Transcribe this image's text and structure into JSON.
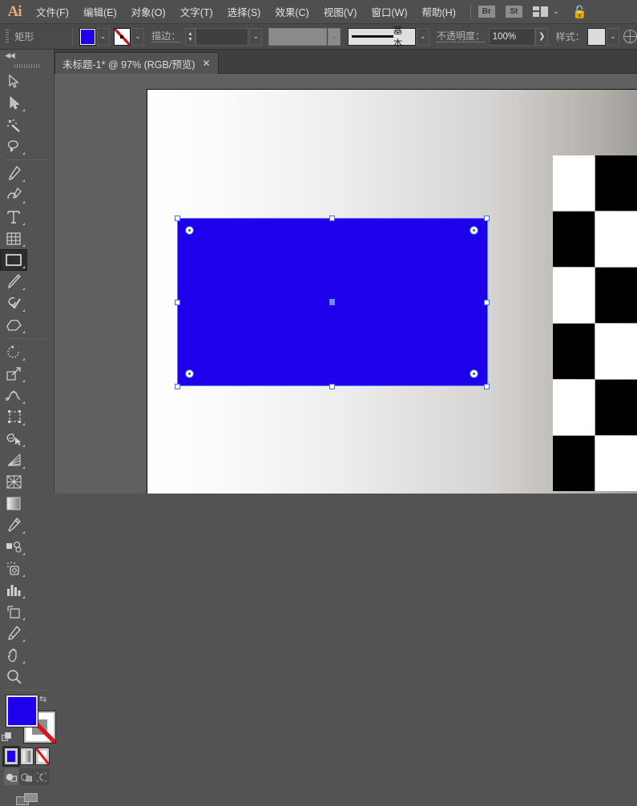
{
  "app": {
    "name": "Adobe Illustrator",
    "logo": "Ai"
  },
  "menubar": {
    "items": [
      {
        "label": "文件(F)",
        "name": "menu-file"
      },
      {
        "label": "编辑(E)",
        "name": "menu-edit"
      },
      {
        "label": "对象(O)",
        "name": "menu-object"
      },
      {
        "label": "文字(T)",
        "name": "menu-type"
      },
      {
        "label": "选择(S)",
        "name": "menu-select"
      },
      {
        "label": "效果(C)",
        "name": "menu-effect"
      },
      {
        "label": "视图(V)",
        "name": "menu-view"
      },
      {
        "label": "窗口(W)",
        "name": "menu-window"
      },
      {
        "label": "帮助(H)",
        "name": "menu-help"
      }
    ],
    "bridge_badge": "Br",
    "stock_badge": "St"
  },
  "controlbar": {
    "tool_name": "矩形",
    "fill_color": "#1e00ea",
    "stroke_color": "none",
    "stroke_label": "描边：",
    "stroke_width": "",
    "variable_width": "",
    "brush_label": "基本",
    "opacity_label": "不透明度：",
    "opacity_value": "100%",
    "style_label": "样式："
  },
  "tabbar": {
    "document_title": "未标题-1* @ 97% (RGB/预览)",
    "close_glyph": "✕"
  },
  "toolpanel": {
    "collapse_glyph": "◀◀",
    "tools": [
      {
        "name": "selection-tool",
        "label": "选择工具",
        "selected": false
      },
      {
        "name": "direct-selection-tool",
        "label": "直接选择工具",
        "selected": false
      },
      {
        "name": "magic-wand-tool",
        "label": "魔棒工具",
        "selected": false
      },
      {
        "name": "lasso-tool",
        "label": "套索工具",
        "selected": false
      },
      {
        "name": "pen-tool",
        "label": "钢笔工具",
        "selected": false
      },
      {
        "name": "curvature-tool",
        "label": "曲率工具",
        "selected": false
      },
      {
        "name": "type-tool",
        "label": "文字工具",
        "selected": false
      },
      {
        "name": "line-segment-tool",
        "label": "直线段工具",
        "selected": false
      },
      {
        "name": "rectangle-tool",
        "label": "矩形工具",
        "selected": true
      },
      {
        "name": "paintbrush-tool",
        "label": "画笔工具",
        "selected": false
      },
      {
        "name": "shaper-tool",
        "label": "Shaper 工具",
        "selected": false
      },
      {
        "name": "eraser-tool",
        "label": "橡皮擦工具",
        "selected": false
      },
      {
        "name": "rotate-tool",
        "label": "旋转工具",
        "selected": false
      },
      {
        "name": "scale-tool",
        "label": "比例缩放工具",
        "selected": false
      },
      {
        "name": "width-tool",
        "label": "宽度工具",
        "selected": false
      },
      {
        "name": "free-transform-tool",
        "label": "自由变换工具",
        "selected": false
      },
      {
        "name": "shape-builder-tool",
        "label": "形状生成器工具",
        "selected": false
      },
      {
        "name": "perspective-grid-tool",
        "label": "透视网格工具",
        "selected": false
      },
      {
        "name": "mesh-tool",
        "label": "网格工具",
        "selected": false
      },
      {
        "name": "gradient-tool",
        "label": "渐变工具",
        "selected": false
      },
      {
        "name": "eyedropper-tool",
        "label": "吸管工具",
        "selected": false
      },
      {
        "name": "blend-tool",
        "label": "混合工具",
        "selected": false
      },
      {
        "name": "symbol-sprayer-tool",
        "label": "符号喷枪工具",
        "selected": false
      },
      {
        "name": "column-graph-tool",
        "label": "柱形图工具",
        "selected": false
      },
      {
        "name": "artboard-tool",
        "label": "画板工具",
        "selected": false
      },
      {
        "name": "slice-tool",
        "label": "切片工具",
        "selected": false
      },
      {
        "name": "hand-tool",
        "label": "抓手工具",
        "selected": false
      },
      {
        "name": "zoom-tool",
        "label": "缩放工具",
        "selected": false
      }
    ],
    "fill_color": "#1e00ea",
    "stroke_color": "none",
    "color_modes": [
      {
        "name": "color-mode-solid",
        "label": "颜色",
        "selected": true
      },
      {
        "name": "color-mode-gradient",
        "label": "渐变",
        "selected": false
      },
      {
        "name": "color-mode-none",
        "label": "无",
        "selected": false
      }
    ],
    "draw_modes": [
      {
        "name": "draw-normal",
        "label": "正常绘图",
        "selected": true
      },
      {
        "name": "draw-behind",
        "label": "背面绘图",
        "selected": false
      },
      {
        "name": "draw-inside",
        "label": "内部绘图",
        "selected": false
      }
    ],
    "screen_mode": "更改屏幕模式"
  },
  "canvas": {
    "zoom": "97%",
    "color_mode": "RGB",
    "view_mode": "预览",
    "shape": {
      "name": "rectangle",
      "fill": "#1e00ea",
      "selected": true,
      "handle_count": 8,
      "corner_widget_count": 4
    },
    "artboard_background": "gradient-white-to-gray",
    "checker_pattern": "black-white-checkerboard"
  }
}
